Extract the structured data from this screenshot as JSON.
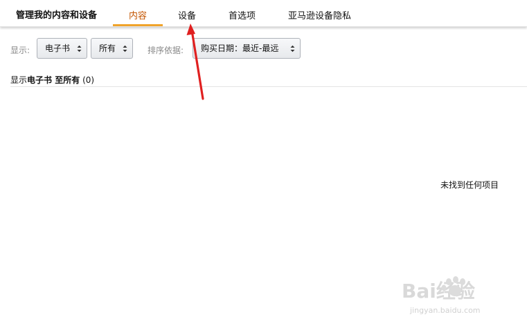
{
  "header": {
    "title": "管理我的内容和设备",
    "tabs": [
      {
        "label": "内容",
        "active": true
      },
      {
        "label": "设备",
        "active": false
      },
      {
        "label": "首选项",
        "active": false
      },
      {
        "label": "亚马逊设备隐私",
        "active": false
      }
    ]
  },
  "filters": {
    "show_label": "显示:",
    "type_select": "电子书",
    "status_select": "所有",
    "sort_label": "排序依据:",
    "sort_select": "购买日期：最近-最远"
  },
  "results": {
    "prefix": "显示",
    "type": "电子书",
    "middle": " 至",
    "status": "所有",
    "count": "(0)",
    "empty_message": "未找到任何项目"
  },
  "watermark": {
    "brand": "Bai经验",
    "url": "jingyan.baidu.com"
  },
  "colors": {
    "active_tab_text": "#c45500",
    "active_tab_underline": "#f0a32a",
    "annotation_arrow": "#e02020"
  },
  "icons": {
    "select_caret": "updown-caret-icon",
    "annotation": "red-arrow-icon",
    "watermark": "baidu-paw-icon"
  }
}
